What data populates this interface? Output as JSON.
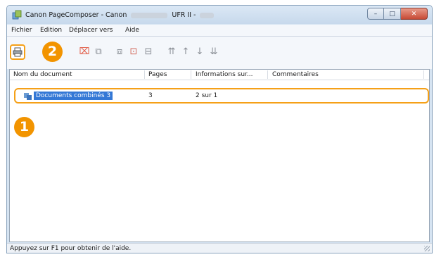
{
  "window": {
    "title": "Canon PageComposer - Canon",
    "title_driver": "UFR II -",
    "buttons": [
      "–",
      "□",
      "✕"
    ]
  },
  "menu": [
    "Fichier",
    "Edition",
    "Déplacer vers",
    "Aide"
  ],
  "badges": {
    "first": "1",
    "second": "2"
  },
  "columns": [
    "Nom du document",
    "Pages",
    "Informations sur...",
    "Commentaires"
  ],
  "rows": [
    {
      "name": "Documents combinés 3",
      "pages": "3",
      "info": "2 sur 1",
      "comments": ""
    }
  ],
  "status": "Appuyez sur F1 pour obtenir de l'aide.",
  "toolbar_icons": [
    "print-icon",
    "delete-icon",
    "combine-icon",
    "split-icon",
    "edit-icon",
    "preview-icon",
    "move-top-icon",
    "move-up-icon",
    "move-down-icon",
    "move-bottom-icon"
  ],
  "colors": {
    "highlight": "#f5a017",
    "badge": "#f29400",
    "selection": "#3478d6"
  }
}
